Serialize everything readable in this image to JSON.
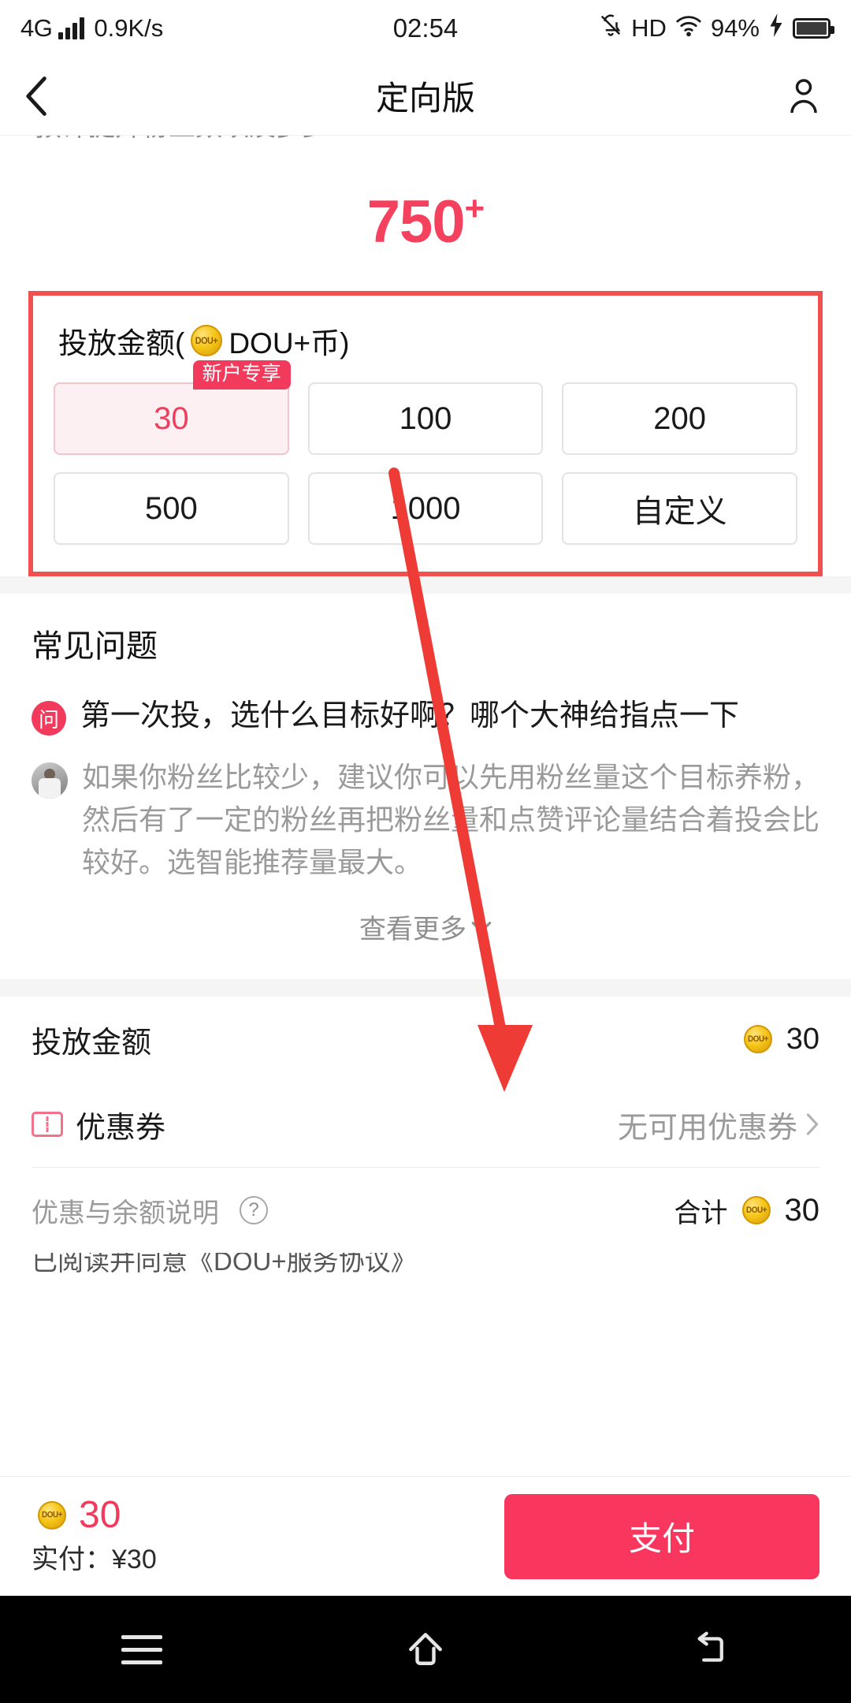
{
  "status_bar": {
    "network": "4G",
    "speed": "0.9K/s",
    "time": "02:54",
    "hd": "HD",
    "battery_percent": "94%"
  },
  "header": {
    "title": "定向版",
    "back_icon": "chevron-left-icon",
    "account_icon": "person-icon"
  },
  "clipped_top_text": "预计提升粉丝数以及多少",
  "estimate": {
    "value": "750",
    "suffix": "+"
  },
  "amount_section": {
    "label_prefix": "投放金额(",
    "label_suffix": "DOU+币)",
    "options": [
      {
        "label": "30",
        "badge": "新户专享",
        "selected": true
      },
      {
        "label": "100",
        "badge": "",
        "selected": false
      },
      {
        "label": "200",
        "badge": "",
        "selected": false
      },
      {
        "label": "500",
        "badge": "",
        "selected": false
      },
      {
        "label": "1000",
        "badge": "",
        "selected": false
      },
      {
        "label": "自定义",
        "badge": "",
        "selected": false
      }
    ]
  },
  "faq": {
    "title": "常见问题",
    "question_badge": "问",
    "question": "第一次投，选什么目标好啊？哪个大神给指点一下",
    "answer": "如果你粉丝比较少，建议你可以先用粉丝量这个目标养粉，然后有了一定的粉丝再把粉丝量和点赞评论量结合着投会比较好。选智能推荐量最大。",
    "see_more": "查看更多"
  },
  "summary": {
    "amount_label": "投放金额",
    "amount_value": "30",
    "coupon_label": "优惠券",
    "coupon_value": "无可用优惠券",
    "note_label": "优惠与余额说明",
    "total_label": "合计",
    "total_value": "30"
  },
  "agreement": "已阅读并同意《DOU+服务协议》",
  "bottom_bar": {
    "coins": "30",
    "real_pay": "实付：¥30",
    "pay_button": "支付"
  },
  "nav_bar": {
    "menu_icon": "menu-icon",
    "home_icon": "home-icon",
    "back_icon": "back-arrow-icon"
  },
  "colors": {
    "accent_red": "#f23b5c",
    "annotation_red": "#ef3b36",
    "coin_gold": "#f5c518"
  }
}
